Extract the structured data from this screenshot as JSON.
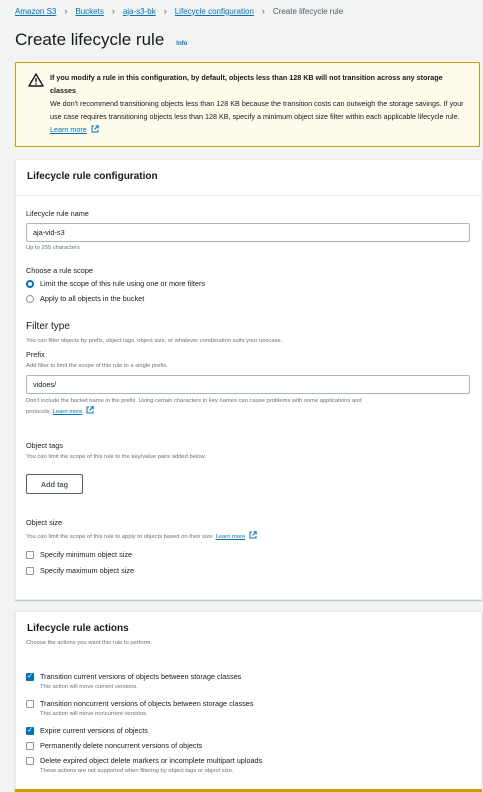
{
  "breadcrumb": {
    "items": [
      "Amazon S3",
      "Buckets",
      "aja-s3-bk",
      "Lifecycle configuration"
    ],
    "current": "Create lifecycle rule"
  },
  "page": {
    "title": "Create lifecycle rule",
    "info": "Info"
  },
  "alert": {
    "title": "If you modify a rule in this configuration, by default, objects less than 128 KB will not transition across any storage classes",
    "body": "We don't recommend transitioning objects less than 128 KB because the transition costs can outweigh the storage savings. If your use case requires transitioning objects less than 128 KB, specify a minimum object size filter within each applicable lifecycle rule.",
    "link": "Learn more"
  },
  "config": {
    "header": "Lifecycle rule configuration",
    "name_label": "Lifecycle rule name",
    "name_value": "aja-vid-s3",
    "name_hint": "Up to 255 characters",
    "scope_label": "Choose a rule scope",
    "scope_options": [
      "Limit the scope of this rule using one or more filters",
      "Apply to all objects in the bucket"
    ],
    "scope_selected": 0,
    "filter_title": "Filter type",
    "filter_desc": "You can filter objects by prefix, object tags, object size, or whatever combination suits your usecase.",
    "prefix_label": "Prefix",
    "prefix_desc": "Add filter to limit the scope of this rule to a single prefix.",
    "prefix_value": "vidoes/",
    "prefix_hint": "Don't include the bucket name in the prefix. Using certain characters in key names can cause problems with some applications and",
    "prefix_hint2": "protocols.",
    "prefix_link": "Learn more",
    "tags_label": "Object tags",
    "tags_desc": "You can limit the scope of this rule to the key/value pairs added below.",
    "add_tag": "Add tag",
    "size_label": "Object size",
    "size_desc": "You can limit the scope of this rule to apply to objects based on their size.",
    "size_link": "Learn more",
    "size_min": "Specify minimum object size",
    "size_max": "Specify maximum object size"
  },
  "actions": {
    "header": "Lifecycle rule actions",
    "desc": "Choose the actions you want this rule to perform.",
    "items": [
      {
        "label": "Transition current versions of objects between storage classes",
        "checked": true,
        "desc": "This action will move current versions."
      },
      {
        "label": "Transition noncurrent versions of objects between storage classes",
        "checked": false,
        "desc": "This action will move noncurrent versions."
      },
      {
        "label": "Expire current versions of objects",
        "checked": true,
        "desc": ""
      },
      {
        "label": "Permanently delete noncurrent versions of objects",
        "checked": false,
        "desc": ""
      },
      {
        "label": "Delete expired object delete markers or incomplete multipart uploads",
        "checked": false,
        "desc": "These actions are not supported when filtering by object tags or object size."
      }
    ]
  },
  "colors": {
    "link": "#0073bb",
    "warning_border": "#d09a00",
    "warning_bg": "#fffbeb",
    "checked": "#0073bb"
  }
}
